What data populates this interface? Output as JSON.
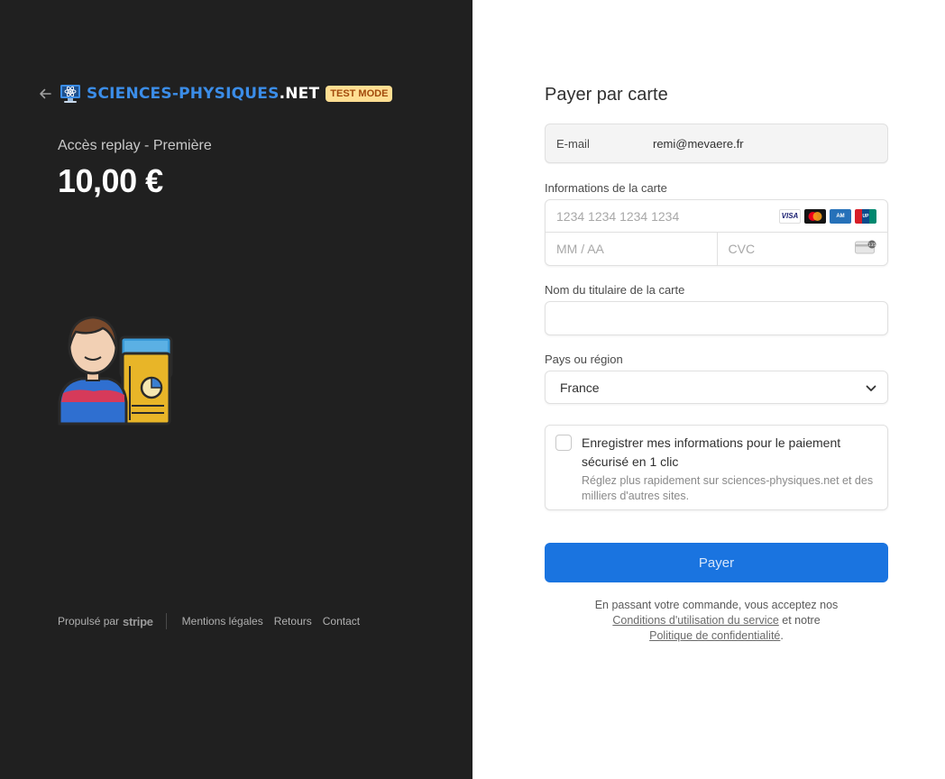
{
  "merchant": {
    "name_part1": "SCIENCES-PHYSIQUES",
    "name_part2": ".NET",
    "test_badge": "TEST MODE",
    "logo_icon": "monitor-atom-icon",
    "back_icon": "arrow-left-icon"
  },
  "product": {
    "name": "Accès replay - Première",
    "price": "10,00 €",
    "image": "student-with-whiteboard-illustration"
  },
  "footer": {
    "powered_by": "Propulsé par",
    "stripe": "stripe",
    "links": [
      "Mentions légales",
      "Retours",
      "Contact"
    ]
  },
  "form": {
    "title": "Payer par carte",
    "email_label": "E-mail",
    "email_value": "remi@mevaere.fr",
    "card_label": "Informations de la carte",
    "card_number_placeholder": "1234 1234 1234 1234",
    "expiry_placeholder": "MM / AA",
    "cvc_placeholder": "CVC",
    "card_brands": [
      "VISA",
      "mastercard",
      "amex",
      "unionpay"
    ],
    "cvc_icon": "card-cvc-icon",
    "cardholder_label": "Nom du titulaire de la carte",
    "cardholder_value": "",
    "country_label": "Pays ou région",
    "country_value": "France",
    "save_title": "Enregistrer mes informations pour le paiement sécurisé en 1 clic",
    "save_desc": "Réglez plus rapidement sur sciences-physiques.net et des milliers d'autres sites.",
    "pay_button": "Payer",
    "terms_1": "En passant votre commande, vous acceptez nos",
    "terms_link1": "Conditions d'utilisation du service",
    "terms_2": "et notre",
    "terms_link2": "Politique de confidentialité",
    "terms_3": "."
  },
  "colors": {
    "left_bg": "#202020",
    "accent_blue": "#1a74e0",
    "brand_blue": "#3b8de8",
    "badge_bg": "#ffde92",
    "badge_text": "#a1490b"
  }
}
